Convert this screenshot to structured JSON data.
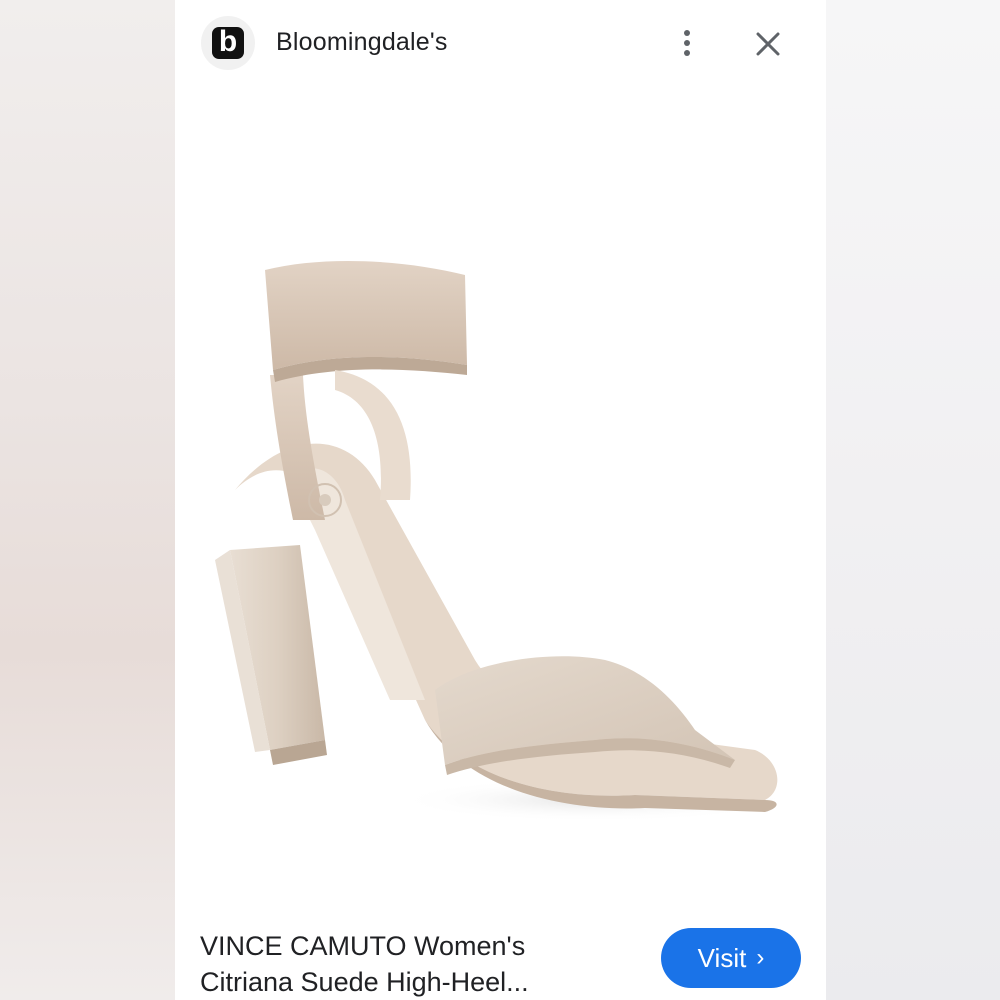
{
  "source": {
    "name": "Bloomingdale's",
    "logo_letter": "b"
  },
  "header": {
    "more_icon": "more-vert-icon",
    "close_icon": "close-icon"
  },
  "product": {
    "title_line1": "VINCE CAMUTO Women's",
    "title_line2": "Citriana Suede High-Heel...",
    "image_subject": "beige suede block-heel sandal with elastic ankle strap"
  },
  "actions": {
    "visit_label": "Visit",
    "visit_chevron": "›"
  },
  "colors": {
    "accent": "#1a73e8",
    "sandal_suede": "#ddcfc1",
    "sandal_strap": "#d6c3b2"
  }
}
